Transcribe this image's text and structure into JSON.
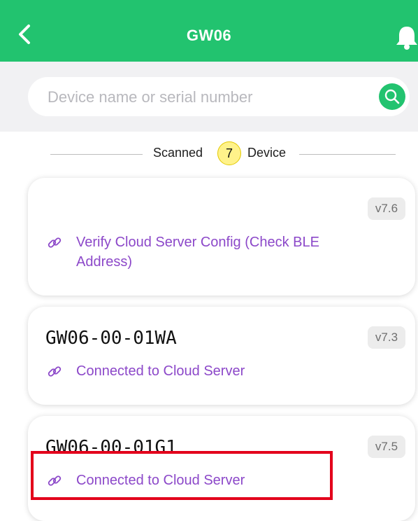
{
  "header": {
    "title": "GW06",
    "back_icon": "chevron-left-icon",
    "notification_icon": "bell-icon",
    "background_color": "#22c36f"
  },
  "search": {
    "placeholder": "Device name or serial number",
    "value": "",
    "button_icon": "search-icon"
  },
  "scan_summary": {
    "prefix": "Scanned",
    "count": "7",
    "suffix": "Device"
  },
  "devices": [
    {
      "name": "",
      "version": "v7.6",
      "status": "Verify Cloud Server Config (Check BLE Address)",
      "status_icon": "link-icon"
    },
    {
      "name": "GW06-00-01WA",
      "version": "v7.3",
      "status": "Connected to Cloud Server",
      "status_icon": "link-icon"
    },
    {
      "name": "GW06-00-01G1",
      "version": "v7.5",
      "status": "Connected to Cloud Server",
      "status_icon": "link-icon"
    }
  ],
  "colors": {
    "accent": "#22c36f",
    "status_text": "#8c48c9",
    "highlight": "#e3001b",
    "count_badge": "#fff28a"
  }
}
